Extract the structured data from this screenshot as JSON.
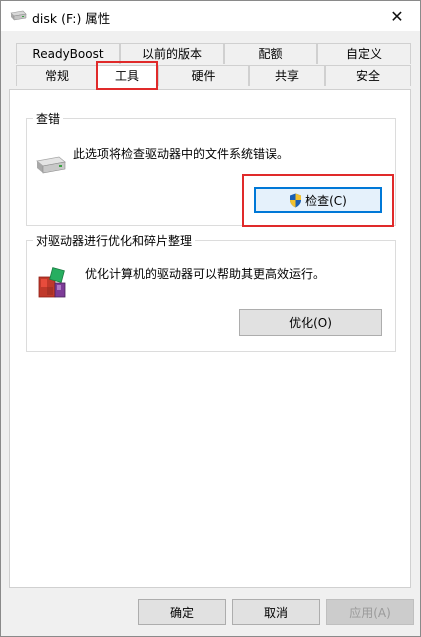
{
  "window": {
    "title": "disk (F:) 属性",
    "close_label": "✕"
  },
  "tabs_top": [
    "ReadyBoost",
    "以前的版本",
    "配额",
    "自定义"
  ],
  "tabs_bottom": [
    "常规",
    "工具",
    "硬件",
    "共享",
    "安全"
  ],
  "active_tab": "工具",
  "check_group": {
    "title": "查错",
    "description": "此选项将检查驱动器中的文件系统错误。",
    "button_label": "检查(C)"
  },
  "optimize_group": {
    "title": "对驱动器进行优化和碎片整理",
    "description": "优化计算机的驱动器可以帮助其更高效运行。",
    "button_label": "优化(O)"
  },
  "footer": {
    "ok_label": "确定",
    "cancel_label": "取消",
    "apply_label": "应用(A)"
  },
  "colors": {
    "highlight": "#e02a2a",
    "accent": "#0078d7"
  }
}
